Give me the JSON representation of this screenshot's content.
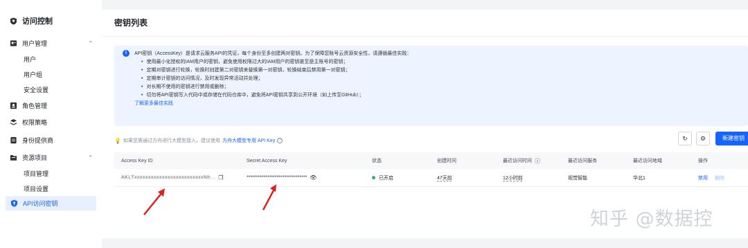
{
  "sidebar": {
    "title": "访问控制",
    "groups": {
      "user_mgmt": "用户管理",
      "role_mgmt": "角色管理",
      "policy": "权限策略",
      "idp": "身份提供商",
      "resource": "资源项目"
    },
    "user_items": [
      "用户",
      "用户组",
      "安全设置"
    ],
    "resource_items": [
      "项目管理",
      "项目设置"
    ],
    "active": "API访问密钥"
  },
  "main": {
    "title": "密钥列表",
    "notice": {
      "head": "API密钥（AccessKey）是请求云服务API的凭证，每个身份至多创建两对密钥。为了保障您账号云资源安全性，请遵循最佳实践：",
      "items": [
        "使用最小化授权的IAM用户的密钥，避免使用权限过大的IAM用户的密钥甚至是主账号的密钥；",
        "定期对密钥进行轮换，轮换时创建第二对密钥来替换第一对密钥，轮换结束后禁用第一对密钥；",
        "定期审计密钥的访问情况，及时发现异常活动并处理；",
        "对长期不使用的密钥进行禁用或删除；",
        "切勿将API密钥写入代码中或存储在代码仓库中，避免将API密钥共享到公开环境（如上传至GitHub）；"
      ],
      "link": "了解更多最佳实践"
    },
    "tip": {
      "text": "如果您需通过方舟进行大模型接入，建议使用",
      "link": "方舟大模型专用 API Key"
    },
    "create_button": "新建密钥",
    "table": {
      "headers": {
        "id": "Access Key ID",
        "secret": "Secret Access Key",
        "status": "状态",
        "created": "创建时间",
        "last_access": "最近访问时间",
        "last_service": "最近访问服务",
        "last_region": "最近访问地域",
        "ops": "操作"
      },
      "row": {
        "id": "AKLTxxxxxxxxxxxxxxxxxxxxxxxxxNh...",
        "secret": "********************************",
        "status": "已开启",
        "created": "47天前",
        "last_access": "12小时前",
        "last_service": "视觉智能",
        "last_region": "华北1",
        "disable": "禁用",
        "delete": "删除"
      }
    }
  },
  "watermark": "知乎 @数据控",
  "colors": {
    "accent": "#1664ff",
    "success": "#30b566",
    "notice_bg": "#eef4ff",
    "arrow": "#e0201b"
  }
}
